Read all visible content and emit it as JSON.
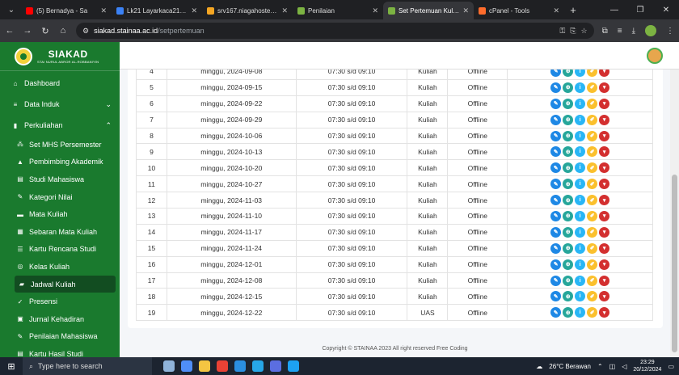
{
  "browser": {
    "tabs": [
      {
        "title": "(5) Bernadya - Sa",
        "fav_color": "#ff0000",
        "active": false
      },
      {
        "title": "Lk21 Layarkaca21 No",
        "fav_color": "#3b82f6",
        "active": false
      },
      {
        "title": "srv167.niagahoster.co",
        "fav_color": "#f5a623",
        "active": false
      },
      {
        "title": "Penilaian",
        "fav_color": "#7cb342",
        "active": false
      },
      {
        "title": "Set Pertemuan Kuliah",
        "fav_color": "#7cb342",
        "active": true
      },
      {
        "title": "cPanel - Tools",
        "fav_color": "#ff6c2c",
        "active": false
      }
    ],
    "url_domain": "siakad.stainaa.ac.id",
    "url_path": "/setpertemuan"
  },
  "app": {
    "brand_name": "SIAKAD",
    "brand_sub": "STAI NURUL ABROR AL-ROBBANIYIN",
    "menu": [
      {
        "label": "Dashboard",
        "icon": "home-icon",
        "glyph": "⌂",
        "type": "top",
        "arrow": ""
      },
      {
        "label": "Data Induk",
        "icon": "database-icon",
        "glyph": "≡",
        "type": "top",
        "arrow": "⌄"
      },
      {
        "label": "Perkuliahan",
        "icon": "book-icon",
        "glyph": "▮",
        "type": "top",
        "arrow": "⌃"
      },
      {
        "label": "Set MHS Persemester",
        "icon": "users-icon",
        "glyph": "⁂",
        "type": "sub",
        "arrow": ""
      },
      {
        "label": "Pembimbing Akademik",
        "icon": "graduation-cap-icon",
        "glyph": "▲",
        "type": "sub",
        "arrow": ""
      },
      {
        "label": "Studi Mahasiswa",
        "icon": "document-icon",
        "glyph": "▤",
        "type": "sub",
        "arrow": ""
      },
      {
        "label": "Kategori Nilai",
        "icon": "edit-document-icon",
        "glyph": "✎",
        "type": "sub",
        "arrow": ""
      },
      {
        "label": "Mata Kuliah",
        "icon": "book-icon",
        "glyph": "▬",
        "type": "sub",
        "arrow": ""
      },
      {
        "label": "Sebaran Mata Kuliah",
        "icon": "grid-icon",
        "glyph": "▦",
        "type": "sub",
        "arrow": ""
      },
      {
        "label": "Kartu Rencana Studi",
        "icon": "list-icon",
        "glyph": "☰",
        "type": "sub",
        "arrow": ""
      },
      {
        "label": "Kelas Kuliah",
        "icon": "circle-icon",
        "glyph": "◎",
        "type": "sub",
        "arrow": ""
      },
      {
        "label": "Jadwal Kuliah",
        "icon": "car-icon",
        "glyph": "▰",
        "type": "sub",
        "arrow": "",
        "active": true
      },
      {
        "label": "Presensi",
        "icon": "clipboard-icon",
        "glyph": "✓",
        "type": "sub",
        "arrow": ""
      },
      {
        "label": "Jurnal Kehadiran",
        "icon": "journal-icon",
        "glyph": "▣",
        "type": "sub",
        "arrow": ""
      },
      {
        "label": "Penilaian Mahasiswa",
        "icon": "edit-document-icon",
        "glyph": "✎",
        "type": "sub",
        "arrow": ""
      },
      {
        "label": "Kartu Hasil Studi",
        "icon": "document-icon",
        "glyph": "▤",
        "type": "sub",
        "arrow": ""
      }
    ],
    "rows": [
      {
        "no": "4",
        "date": "minggu, 2024-09-08",
        "time": "07:30 s/d 09:10",
        "type": "Kuliah",
        "mode": "Offline"
      },
      {
        "no": "5",
        "date": "minggu, 2024-09-15",
        "time": "07:30 s/d 09:10",
        "type": "Kuliah",
        "mode": "Offline"
      },
      {
        "no": "6",
        "date": "minggu, 2024-09-22",
        "time": "07:30 s/d 09:10",
        "type": "Kuliah",
        "mode": "Offline"
      },
      {
        "no": "7",
        "date": "minggu, 2024-09-29",
        "time": "07:30 s/d 09:10",
        "type": "Kuliah",
        "mode": "Offline"
      },
      {
        "no": "8",
        "date": "minggu, 2024-10-06",
        "time": "07:30 s/d 09:10",
        "type": "Kuliah",
        "mode": "Offline"
      },
      {
        "no": "9",
        "date": "minggu, 2024-10-13",
        "time": "07:30 s/d 09:10",
        "type": "Kuliah",
        "mode": "Offline"
      },
      {
        "no": "10",
        "date": "minggu, 2024-10-20",
        "time": "07:30 s/d 09:10",
        "type": "Kuliah",
        "mode": "Offline"
      },
      {
        "no": "11",
        "date": "minggu, 2024-10-27",
        "time": "07:30 s/d 09:10",
        "type": "Kuliah",
        "mode": "Offline"
      },
      {
        "no": "12",
        "date": "minggu, 2024-11-03",
        "time": "07:30 s/d 09:10",
        "type": "Kuliah",
        "mode": "Offline"
      },
      {
        "no": "13",
        "date": "minggu, 2024-11-10",
        "time": "07:30 s/d 09:10",
        "type": "Kuliah",
        "mode": "Offline"
      },
      {
        "no": "14",
        "date": "minggu, 2024-11-17",
        "time": "07:30 s/d 09:10",
        "type": "Kuliah",
        "mode": "Offline"
      },
      {
        "no": "15",
        "date": "minggu, 2024-11-24",
        "time": "07:30 s/d 09:10",
        "type": "Kuliah",
        "mode": "Offline"
      },
      {
        "no": "16",
        "date": "minggu, 2024-12-01",
        "time": "07:30 s/d 09:10",
        "type": "Kuliah",
        "mode": "Offline"
      },
      {
        "no": "17",
        "date": "minggu, 2024-12-08",
        "time": "07:30 s/d 09:10",
        "type": "Kuliah",
        "mode": "Offline"
      },
      {
        "no": "18",
        "date": "minggu, 2024-12-15",
        "time": "07:30 s/d 09:10",
        "type": "Kuliah",
        "mode": "Offline"
      },
      {
        "no": "19",
        "date": "minggu, 2024-12-22",
        "time": "07:30 s/d 09:10",
        "type": "UAS",
        "mode": "Offline"
      }
    ],
    "row_actions": [
      {
        "icon": "pencil-icon",
        "glyph": "✎",
        "cls": "edit"
      },
      {
        "icon": "globe-icon",
        "glyph": "⊕",
        "cls": "web"
      },
      {
        "icon": "info-icon",
        "glyph": "i",
        "cls": "info"
      },
      {
        "icon": "edit-note-icon",
        "glyph": "✐",
        "cls": "note"
      },
      {
        "icon": "trash-icon",
        "glyph": "▾",
        "cls": "del"
      }
    ],
    "footer": "Copyright © STAINAA 2023 All right reserved Free Coding"
  },
  "taskbar": {
    "search_placeholder": "Type here to search",
    "weather": "26°C  Berawan",
    "time": "23:29",
    "date": "20/12/2024"
  },
  "colors": {
    "sidebar": "#1a7a2e",
    "sidebar_active": "#124d21"
  }
}
